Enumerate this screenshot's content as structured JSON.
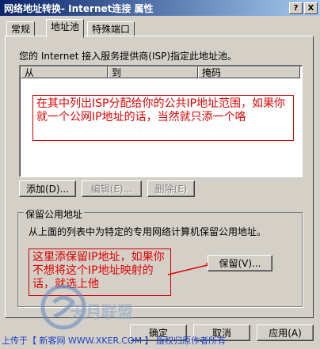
{
  "window": {
    "title": "网络地址转换- Internet连接 属性",
    "help_btn": "?",
    "close_btn": "X"
  },
  "tabs": [
    {
      "label": "常规"
    },
    {
      "label": "地址池"
    },
    {
      "label": "特殊端口"
    }
  ],
  "address_pool": {
    "description": "您的 Internet 接入服务提供商(ISP)指定此地址池。",
    "columns": [
      "从",
      "到",
      "掩码"
    ],
    "annotation": "在其中列出ISP分配给你的公共IP地址范围，如果你就一个公网IP地址的话，当然就只添一个咯",
    "buttons": {
      "add": "添加(D)...",
      "edit": "编辑(E)...",
      "delete": "删除(E)"
    }
  },
  "reserve": {
    "group_label": "保留公用地址",
    "description": "从上面的列表中为特定的专用网络计算机保留公用地址。",
    "button": "保留(V)...",
    "annotation": "这里添保留IP地址，如果你不想将这个IP地址映射的话，就选上他"
  },
  "dialog_buttons": {
    "ok": "确定",
    "cancel": "取消",
    "apply": "应用(A)"
  },
  "watermark": {
    "logo_text": "天月联盟"
  },
  "footer": {
    "text": "上传于【 新客网 WWW.XKER.COM 】 版权归原作者所有"
  },
  "colors": {
    "annotation_red": "#e00000",
    "title_blue": "#0a246a"
  }
}
